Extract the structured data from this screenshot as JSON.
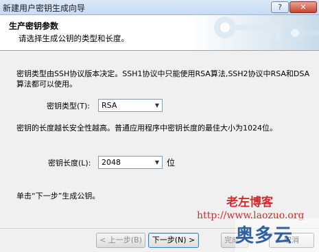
{
  "window": {
    "title": "新建用户密钥生成向导",
    "help_label": "?",
    "close_label": "✕"
  },
  "header": {
    "title": "生产密钥参数",
    "subtitle": "请选择生成公钥的类型和长度。"
  },
  "content": {
    "type_desc": "密钥类型由SSH协议版本决定。SSH1协议中只能使用RSA算法,SSH2协议中RSA和DSA算法都可以使用。",
    "type_label": "密钥类型(T):",
    "type_value": "RSA",
    "length_desc": "密钥的长度越长安全性越高。普通应用程序中密钥长度的最佳大小为1024位。",
    "length_label": "密钥长度(L):",
    "length_value": "2048",
    "length_unit": "位",
    "hint": "单击“下一步”生成公钥。"
  },
  "watermark": {
    "name": "老左博客",
    "url": "http://www.laozuo.org",
    "brand": "奥多云"
  },
  "buttons": {
    "back": "< 上一步(B)",
    "next": "下一步(N) >",
    "finish": "完成",
    "cancel": "取消"
  },
  "colors": {
    "watermark": "#d12a2a",
    "brand": "#2d5fa6",
    "title_bar": "#c7dbf2"
  }
}
